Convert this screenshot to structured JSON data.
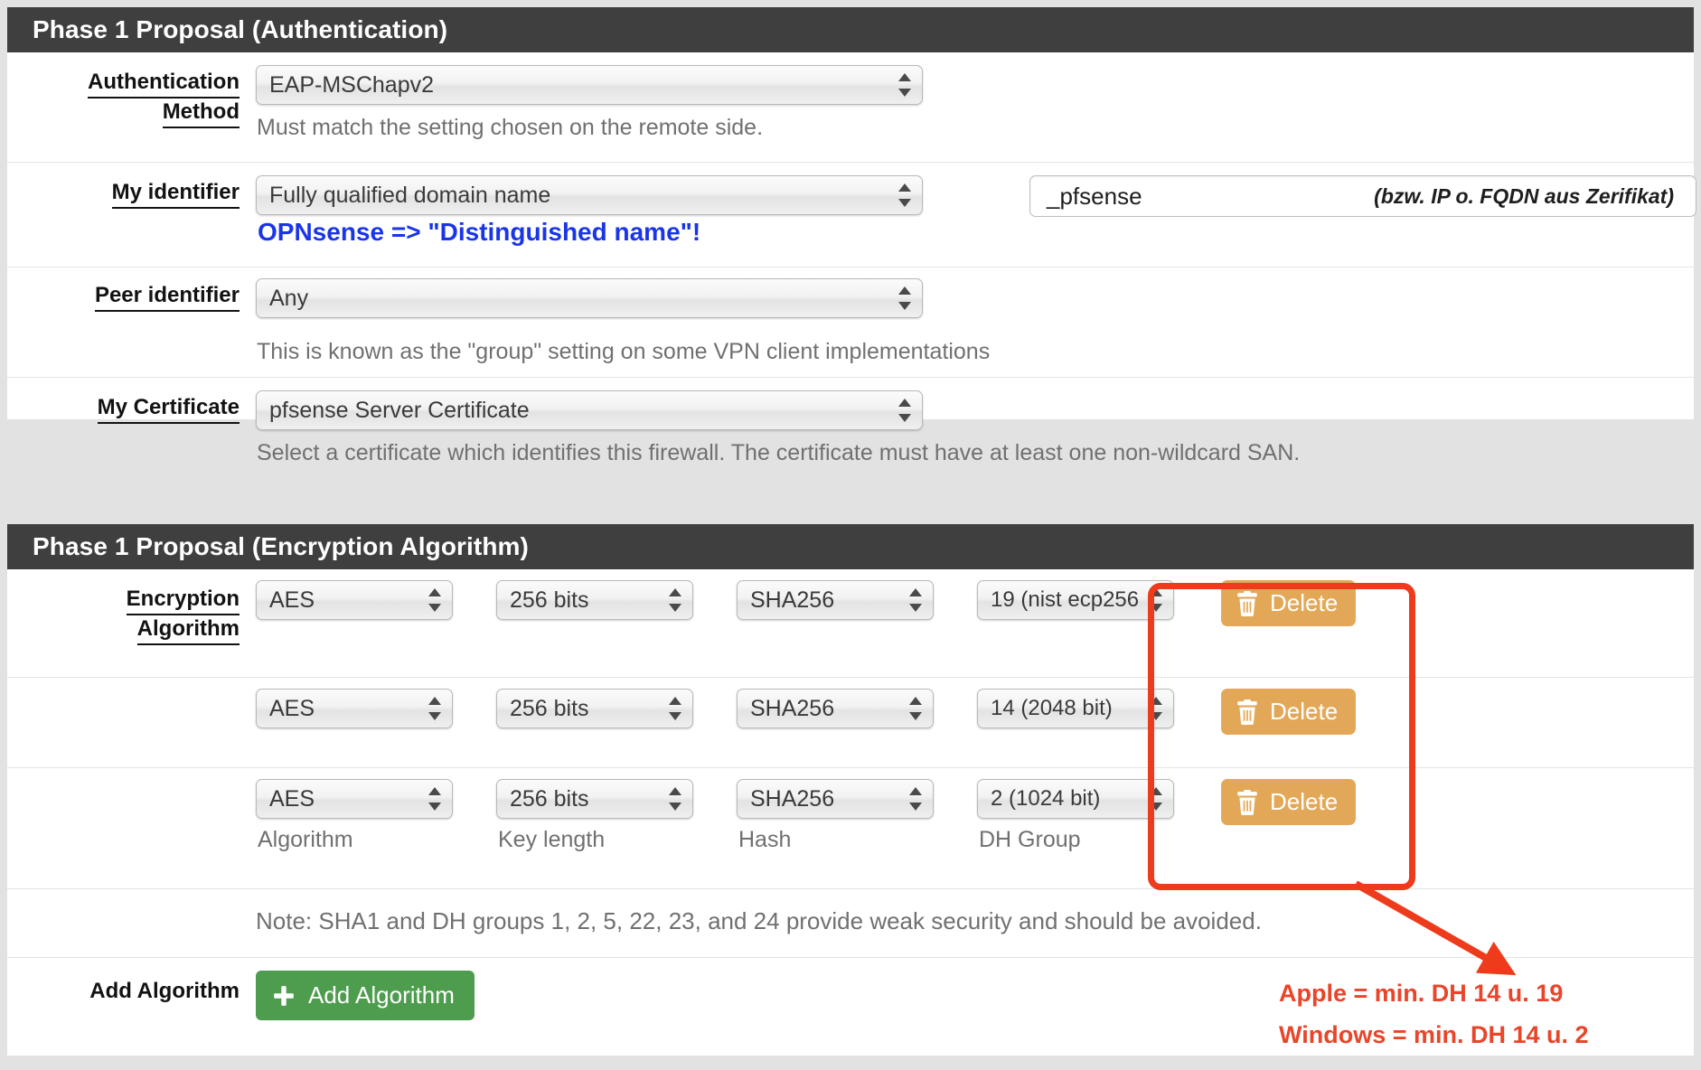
{
  "sections": {
    "auth": {
      "title": "Phase 1 Proposal (Authentication)",
      "rows": {
        "auth_method": {
          "label_line1": "Authentication",
          "label_line2": "Method",
          "select_value": "EAP-MSChapv2",
          "helper": "Must match the setting chosen on the remote side."
        },
        "my_identifier": {
          "label": "My identifier",
          "select_value": "Fully qualified domain name",
          "field_value": "_pfsense",
          "field_note": "(bzw. IP o. FQDN aus Zerifikat)",
          "annotation": "OPNsense => \"Distinguished name\"!"
        },
        "peer_identifier": {
          "label": "Peer identifier",
          "select_value": "Any",
          "helper": "This is known as the \"group\" setting on some VPN client implementations"
        },
        "my_certificate": {
          "label": "My Certificate",
          "select_value": "pfsense Server Certificate",
          "helper": "Select a certificate which identifies this firewall. The certificate must have at least one non-wildcard SAN."
        }
      }
    },
    "encryption": {
      "title": "Phase 1 Proposal (Encryption Algorithm)",
      "label_line1": "Encryption",
      "label_line2": "Algorithm",
      "column_labels": {
        "algorithm": "Algorithm",
        "key_length": "Key length",
        "hash": "Hash",
        "dh_group": "DH Group"
      },
      "rows": [
        {
          "algorithm": "AES",
          "key_length": "256 bits",
          "hash": "SHA256",
          "dh_group": "19 (nist ecp256",
          "delete_label": "Delete"
        },
        {
          "algorithm": "AES",
          "key_length": "256 bits",
          "hash": "SHA256",
          "dh_group": "14 (2048 bit)",
          "delete_label": "Delete"
        },
        {
          "algorithm": "AES",
          "key_length": "256 bits",
          "hash": "SHA256",
          "dh_group": "2 (1024 bit)",
          "delete_label": "Delete"
        }
      ],
      "note": "Note: SHA1 and DH groups 1, 2, 5, 22, 23, and 24 provide weak security and should be avoided.",
      "add_row": {
        "label": "Add Algorithm",
        "button_label": "Add Algorithm"
      },
      "annotation_line1": "Apple = min. DH 14 u. 19",
      "annotation_line2": "Windows = min. DH 14 u. 2"
    }
  },
  "colors": {
    "header_bg": "#3f3f3f",
    "annotation_blue": "#1a35e8",
    "annotation_red": "#e8452a",
    "highlight_red": "#ed3b1b",
    "delete_amber": "#e3a857",
    "add_green": "#4e9c4e"
  }
}
